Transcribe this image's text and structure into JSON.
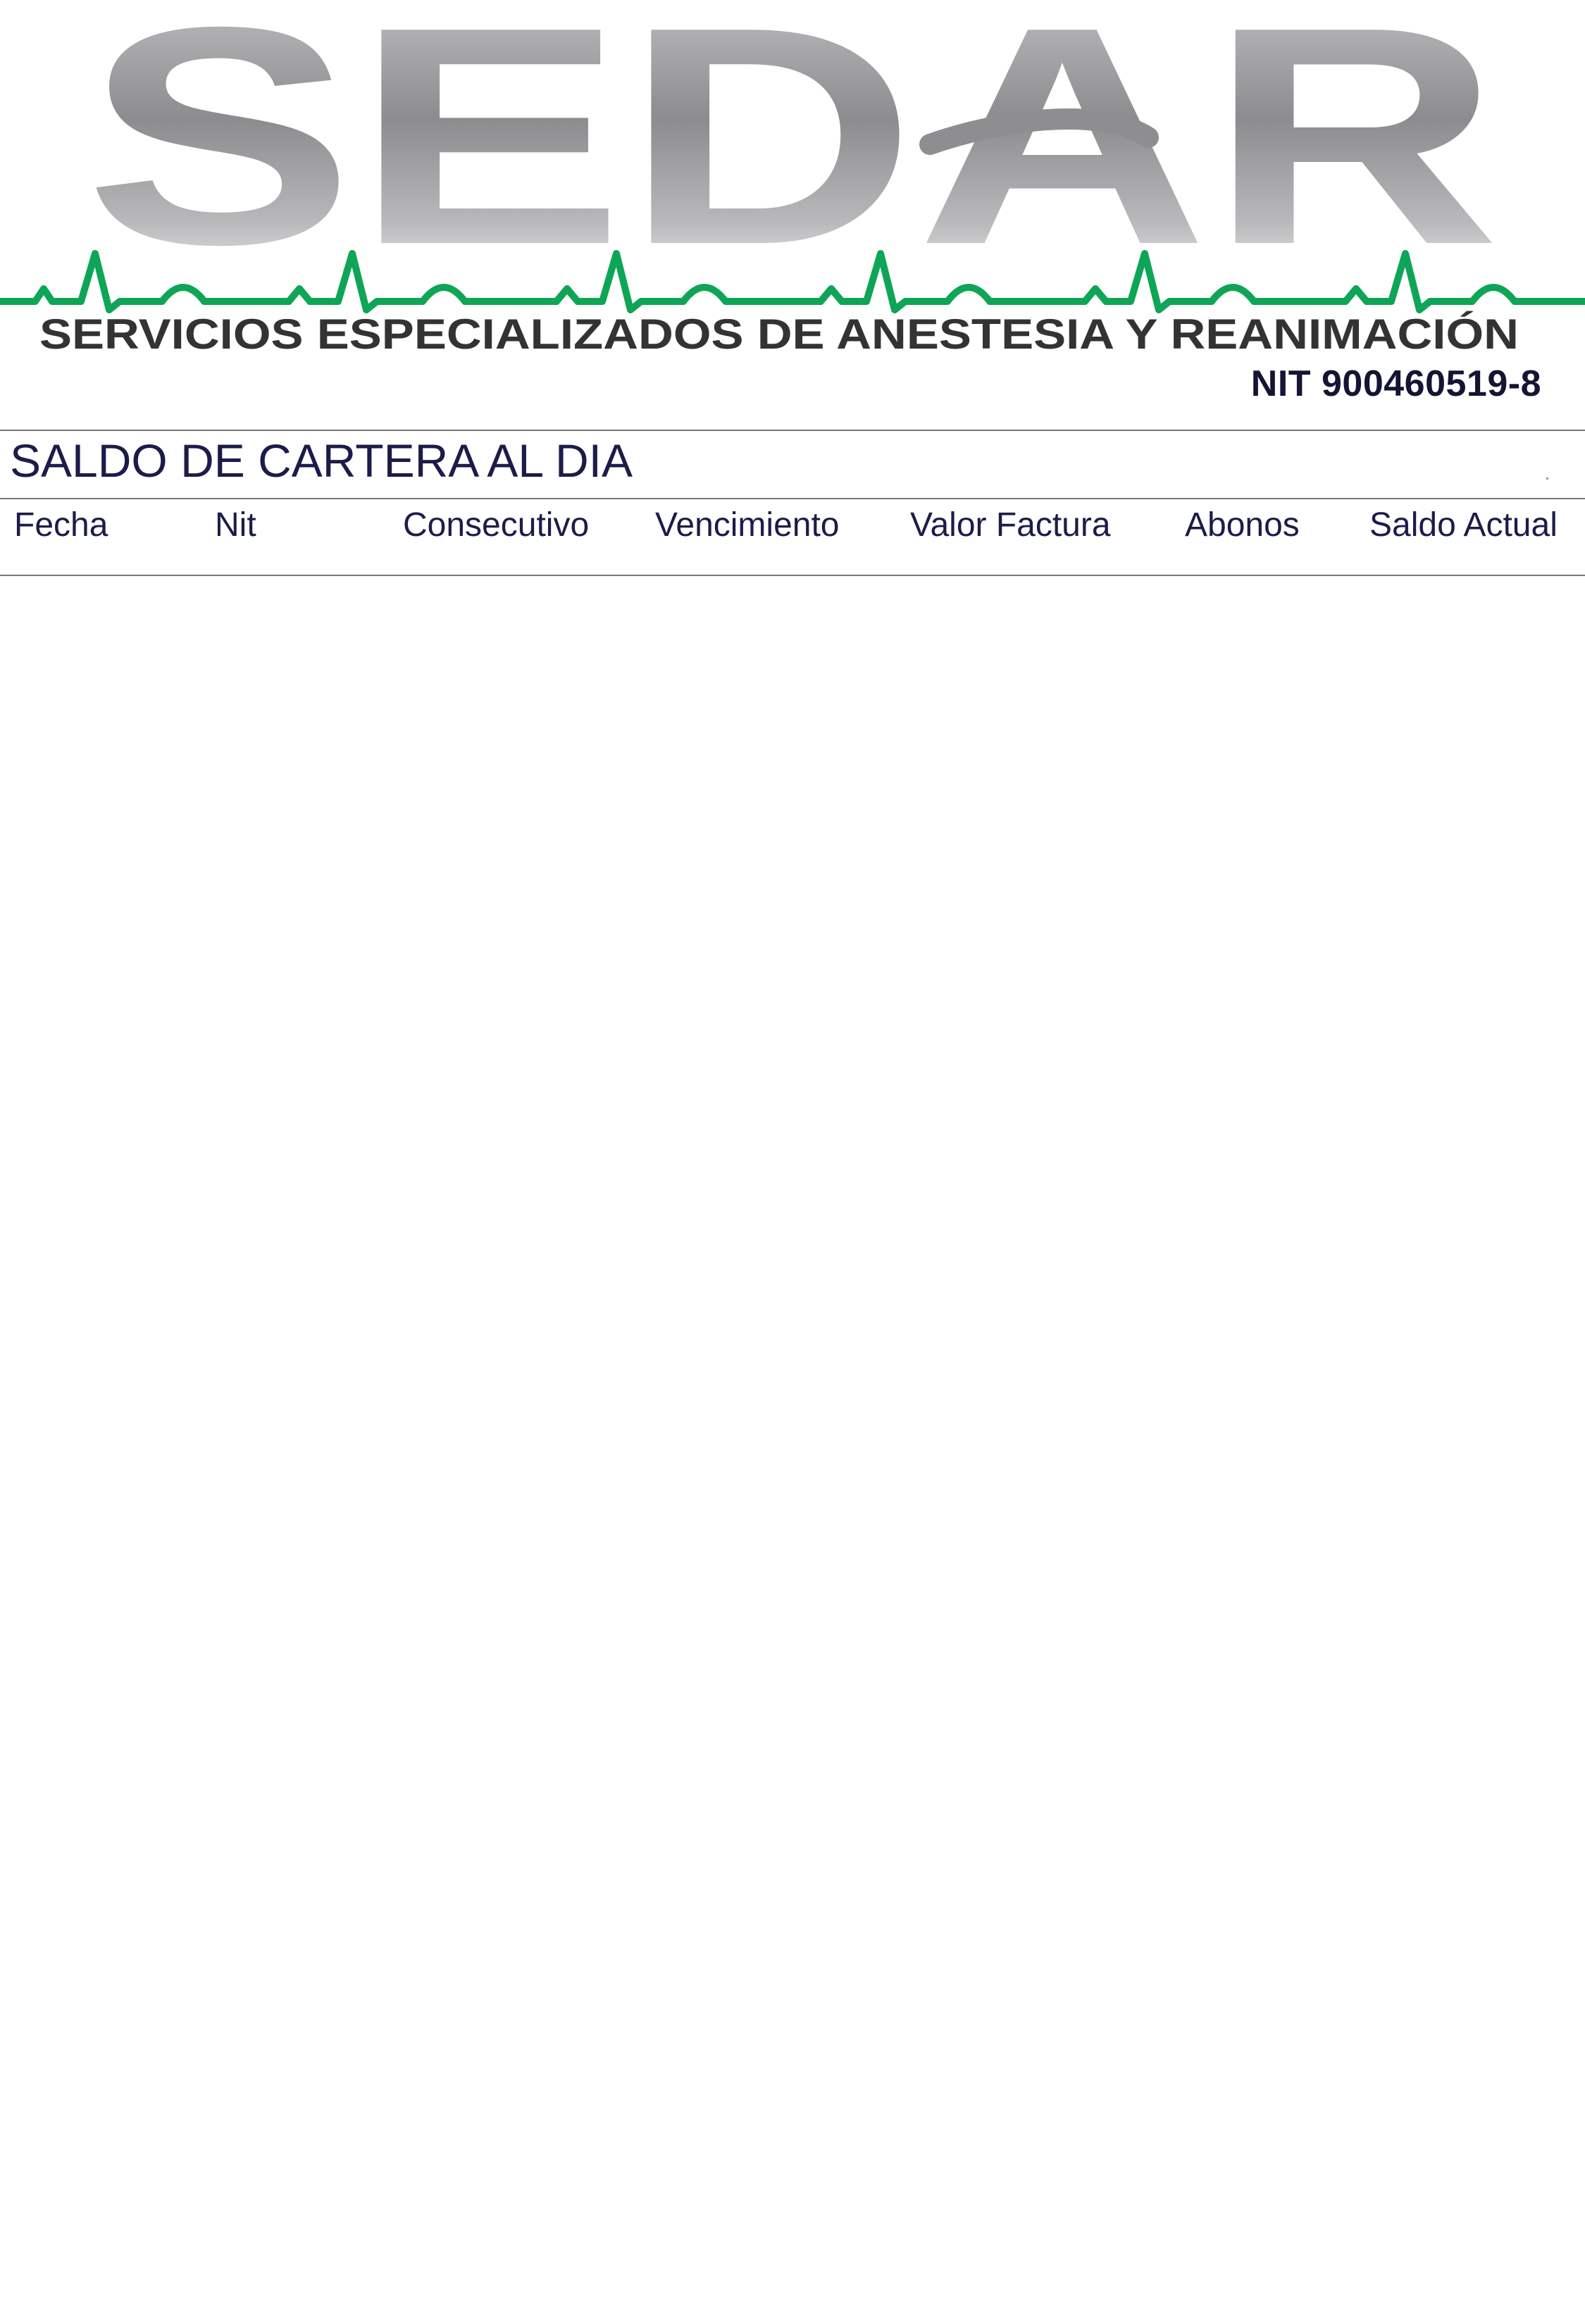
{
  "company": {
    "logo_text": "SEDAR",
    "subtitle": "SERVICIOS ESPECIALIZADOS DE ANESTESIA Y REANIMACIÓN",
    "nit": "NIT 900460519-8",
    "ecg_color": "#0ea557",
    "logo_color": "#8a8a8c",
    "subtitle_color": "#333333"
  },
  "report": {
    "title": "SALDO DE CARTERA AL DIA"
  },
  "table": {
    "columns": [
      "Fecha",
      "Nit",
      "Consecutivo",
      "Vencimiento",
      "Valor Factura",
      "Abonos",
      "Saldo Actual"
    ],
    "rows": []
  }
}
